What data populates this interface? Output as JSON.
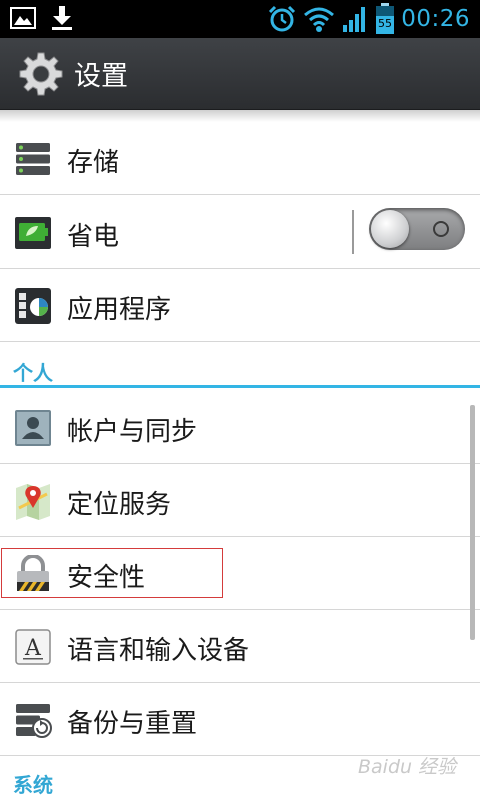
{
  "status_bar": {
    "time": "00:26",
    "battery": "55",
    "icons": [
      "image-icon",
      "download-icon",
      "alarm-icon",
      "wifi-icon",
      "signal-icon",
      "battery-icon"
    ]
  },
  "action_bar": {
    "title": "设置",
    "icon": "settings-gear-icon"
  },
  "items": {
    "storage": {
      "label": "存储",
      "icon": "storage-icon"
    },
    "power_saver": {
      "label": "省电",
      "icon": "battery-saver-icon",
      "toggle_on": false
    },
    "apps": {
      "label": "应用程序",
      "icon": "apps-icon"
    },
    "accounts": {
      "label": "帐户与同步",
      "icon": "account-icon"
    },
    "location": {
      "label": "定位服务",
      "icon": "map-pin-icon"
    },
    "security": {
      "label": "安全性",
      "icon": "padlock-icon"
    },
    "language": {
      "label": "语言和输入设备",
      "icon": "keyboard-a-icon"
    },
    "backup": {
      "label": "备份与重置",
      "icon": "backup-icon"
    }
  },
  "sections": {
    "personal": "个人",
    "system": "系统"
  },
  "watermark": "Baidu 经验",
  "colors": {
    "accent": "#33b5e5",
    "highlight": "#d43b3b",
    "actionbar": "#35383b"
  }
}
